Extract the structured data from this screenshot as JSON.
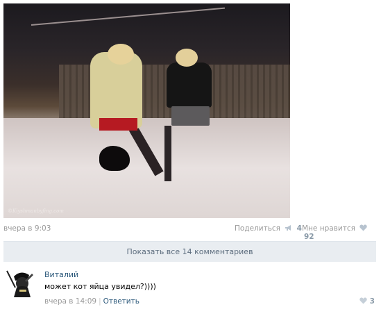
{
  "post": {
    "photo_watermark": "©Kiyshmanbyfing.com",
    "date": "вчера в 9:03",
    "share_label": "Поделиться",
    "share_count": "4",
    "like_label": "Мне нравится",
    "like_count": "92",
    "icons": {
      "share": "megaphone-icon",
      "like": "heart-icon"
    }
  },
  "comments_bar": {
    "label": "Показать все 14 комментариев"
  },
  "comment": {
    "author": "Виталий",
    "text": "может кот яйца увидел?))))",
    "date": "вчера в 14:09",
    "separator": "|",
    "reply_label": "Ответить",
    "like_count": "3"
  },
  "colors": {
    "link": "#2b587a",
    "muted": "#999999",
    "bar_bg": "#e9edf1",
    "counter": "#8a9aa8"
  }
}
